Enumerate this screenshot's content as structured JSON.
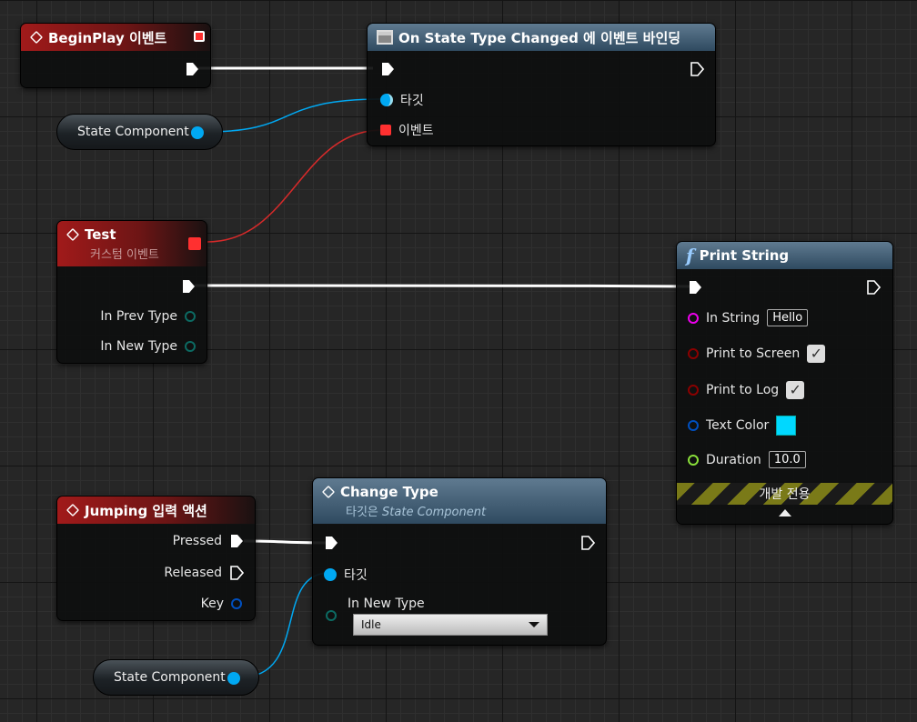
{
  "nodes": {
    "begin_play": {
      "title": "BeginPlay 이벤트"
    },
    "bind_event": {
      "title": "On State Type Changed 에 이벤트 바인딩",
      "pins": {
        "target": "타깃",
        "event": "이벤트"
      }
    },
    "state_component_1": {
      "label": "State Component"
    },
    "test_event": {
      "title": "Test",
      "subtitle": "커스텀 이벤트",
      "pins": {
        "prev": "In Prev Type",
        "new": "In New Type"
      }
    },
    "print_string": {
      "title": "Print String",
      "icon_glyph": "f",
      "pins": {
        "in_string": "In String",
        "in_string_value": "Hello",
        "print_screen": "Print to Screen",
        "print_log": "Print to Log",
        "text_color": "Text Color",
        "duration": "Duration",
        "duration_value": "10.0"
      },
      "dev_only": "개발 전용"
    },
    "jumping": {
      "title": "Jumping 입력 액션",
      "pins": {
        "pressed": "Pressed",
        "released": "Released",
        "key": "Key"
      }
    },
    "change_type": {
      "title": "Change Type",
      "subtitle_prefix": "타깃은",
      "subtitle_target": "State Component",
      "pins": {
        "target": "타깃",
        "new_type": "In New Type"
      },
      "dropdown_value": "Idle"
    },
    "state_component_2": {
      "label": "State Component"
    }
  },
  "colors": {
    "exec": "#ffffff",
    "object": "#00a8f2",
    "delegate": "#ff3030",
    "string": "#ee00ee",
    "bool": "#8b0000",
    "struct": "#0050c0",
    "float": "#8ae03a",
    "enum": "#0c5a52"
  }
}
